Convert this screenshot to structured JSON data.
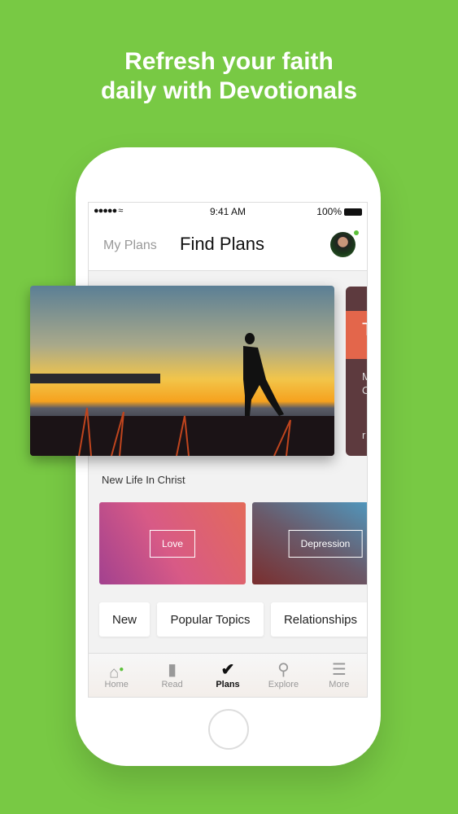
{
  "headline": [
    "Refresh your faith",
    "daily with Devotionals"
  ],
  "status": {
    "signal": "●●●●● ",
    "time": "9:41 AM",
    "battery": "100%"
  },
  "nav": {
    "my_plans": "My Plans",
    "find_plans": "Find Plans"
  },
  "featured": {
    "next_card_fragments": [
      "T",
      "M",
      "O",
      "r"
    ]
  },
  "featured_title": "New Life In Christ",
  "topics": [
    {
      "label": "Love"
    },
    {
      "label": "Depression"
    }
  ],
  "chips": [
    "New",
    "Popular Topics",
    "Relationships"
  ],
  "tabs": [
    {
      "label": "Home",
      "icon": "home-icon"
    },
    {
      "label": "Read",
      "icon": "book-icon"
    },
    {
      "label": "Plans",
      "icon": "check-icon"
    },
    {
      "label": "Explore",
      "icon": "search-icon"
    },
    {
      "label": "More",
      "icon": "menu-icon"
    }
  ],
  "colors": {
    "background": "#78c944",
    "accent": "#5cc13a"
  }
}
